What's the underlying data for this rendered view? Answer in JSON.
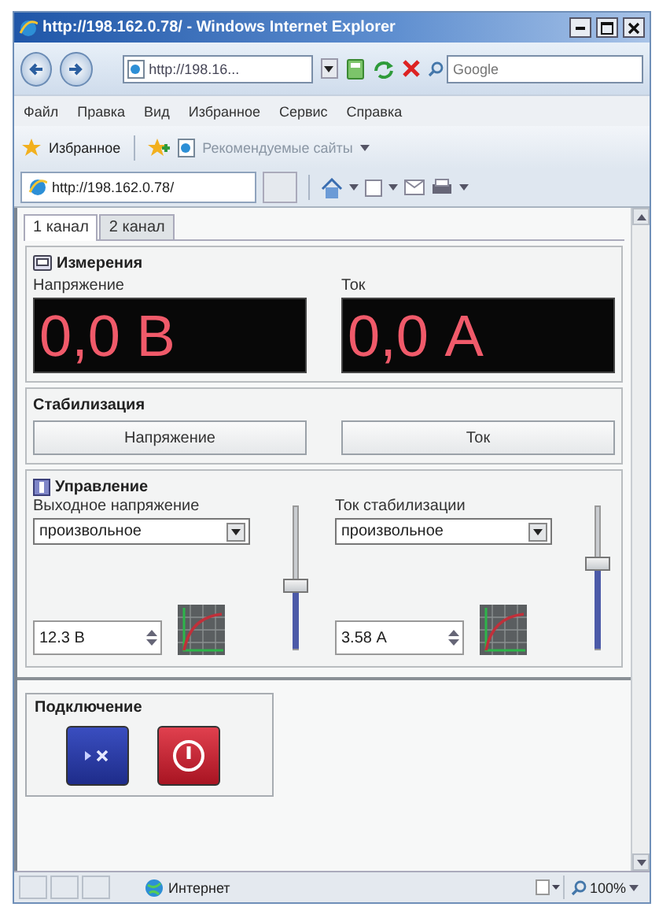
{
  "window": {
    "title": "http://198.162.0.78/ - Windows Internet Explorer"
  },
  "address_bar": {
    "value": "http://198.16..."
  },
  "search": {
    "placeholder": "Google"
  },
  "menu": [
    "Файл",
    "Правка",
    "Вид",
    "Избранное",
    "Сервис",
    "Справка"
  ],
  "favorites_bar": {
    "favorites": "Избранное",
    "suggested_sites": "Рекомендуемые сайты"
  },
  "browser_tab": {
    "title": "http://198.162.0.78/"
  },
  "page_tabs": [
    {
      "label": "1 канал",
      "selected": true
    },
    {
      "label": "2 канал",
      "selected": false
    }
  ],
  "measurement": {
    "title": "Измерения",
    "meters": [
      {
        "label": "Напряжение",
        "reading": "0,0 В"
      },
      {
        "label": "Ток",
        "reading": "0,0 А"
      }
    ]
  },
  "stabilization": {
    "title": "Стабилизация",
    "buttons": [
      "Напряжение",
      "Ток"
    ]
  },
  "control": {
    "title": "Управление",
    "channels": [
      {
        "label": "Выходное напряжение",
        "mode": "произвольное",
        "value": "12.3 В",
        "level": 0.45
      },
      {
        "label": "Ток стабилизации",
        "mode": "произвольное",
        "value": "3.58 А",
        "level": 0.6
      }
    ]
  },
  "connection": {
    "title": "Подключение"
  },
  "status_bar": {
    "zone": "Интернет",
    "zoom": "100%"
  }
}
